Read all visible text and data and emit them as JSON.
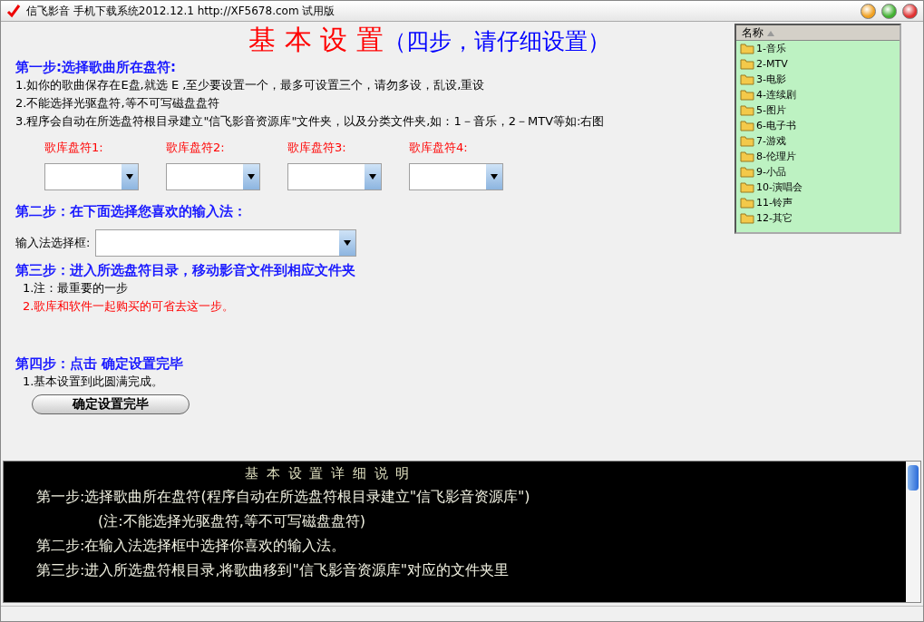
{
  "window": {
    "title": "信飞影音 手机下载系统2012.12.1  http://XF5678.com  试用版"
  },
  "heading": {
    "main": "基 本 设 置",
    "sub": "（四步，请仔细设置）"
  },
  "step1": {
    "title": "第一步:选择歌曲所在盘符:",
    "notes": [
      "1.如你的歌曲保存在E盘,就选 E ,至少要设置一个，最多可设置三个，请勿多设，乱设,重设",
      "2.不能选择光驱盘符,等不可写磁盘盘符",
      "3.程序会自动在所选盘符根目录建立\"信飞影音资源库\"文件夹，以及分类文件夹,如：1－音乐，2－MTV等如:右图"
    ],
    "drives": [
      {
        "label": "歌库盘符1:"
      },
      {
        "label": "歌库盘符2:"
      },
      {
        "label": "歌库盘符3:"
      },
      {
        "label": "歌库盘符4:"
      }
    ]
  },
  "step2": {
    "title": "第二步：在下面选择您喜欢的输入法：",
    "field_label": "输入法选择框:"
  },
  "step3": {
    "title": "第三步：进入所选盘符目录，移动影音文件到相应文件夹",
    "notes": [
      {
        "text": "1.注：最重要的一步",
        "kind": "normal"
      },
      {
        "text": "2.歌库和软件一起购买的可省去这一步。",
        "kind": "warning"
      }
    ]
  },
  "step4": {
    "title": "第四步：点击 确定设置完毕",
    "notes": [
      "1.基本设置到此圆满完成。"
    ],
    "button": "确定设置完毕"
  },
  "folder_list": {
    "column": "名称",
    "items": [
      "1-音乐",
      "2-MTV",
      "3-电影",
      "4-连续剧",
      "5-图片",
      "6-电子书",
      "7-游戏",
      "8-伦理片",
      "9-小品",
      "10-演唱会",
      "11-铃声",
      "12-其它"
    ]
  },
  "details": {
    "title": "基 本 设 置 详 细 说 明",
    "lines": [
      {
        "text": "第一步:选择歌曲所在盘符(程序自动在所选盘符根目录建立\"信飞影音资源库\")",
        "kind": "step"
      },
      {
        "text": "(注:不能选择光驱盘符,等不可写磁盘盘符)",
        "kind": "note"
      },
      {
        "text": "第二步:在输入法选择框中选择你喜欢的输入法。",
        "kind": "step"
      },
      {
        "text": "第三步:进入所选盘符根目录,将歌曲移到\"信飞影音资源库\"对应的文件夹里",
        "kind": "step"
      }
    ]
  }
}
